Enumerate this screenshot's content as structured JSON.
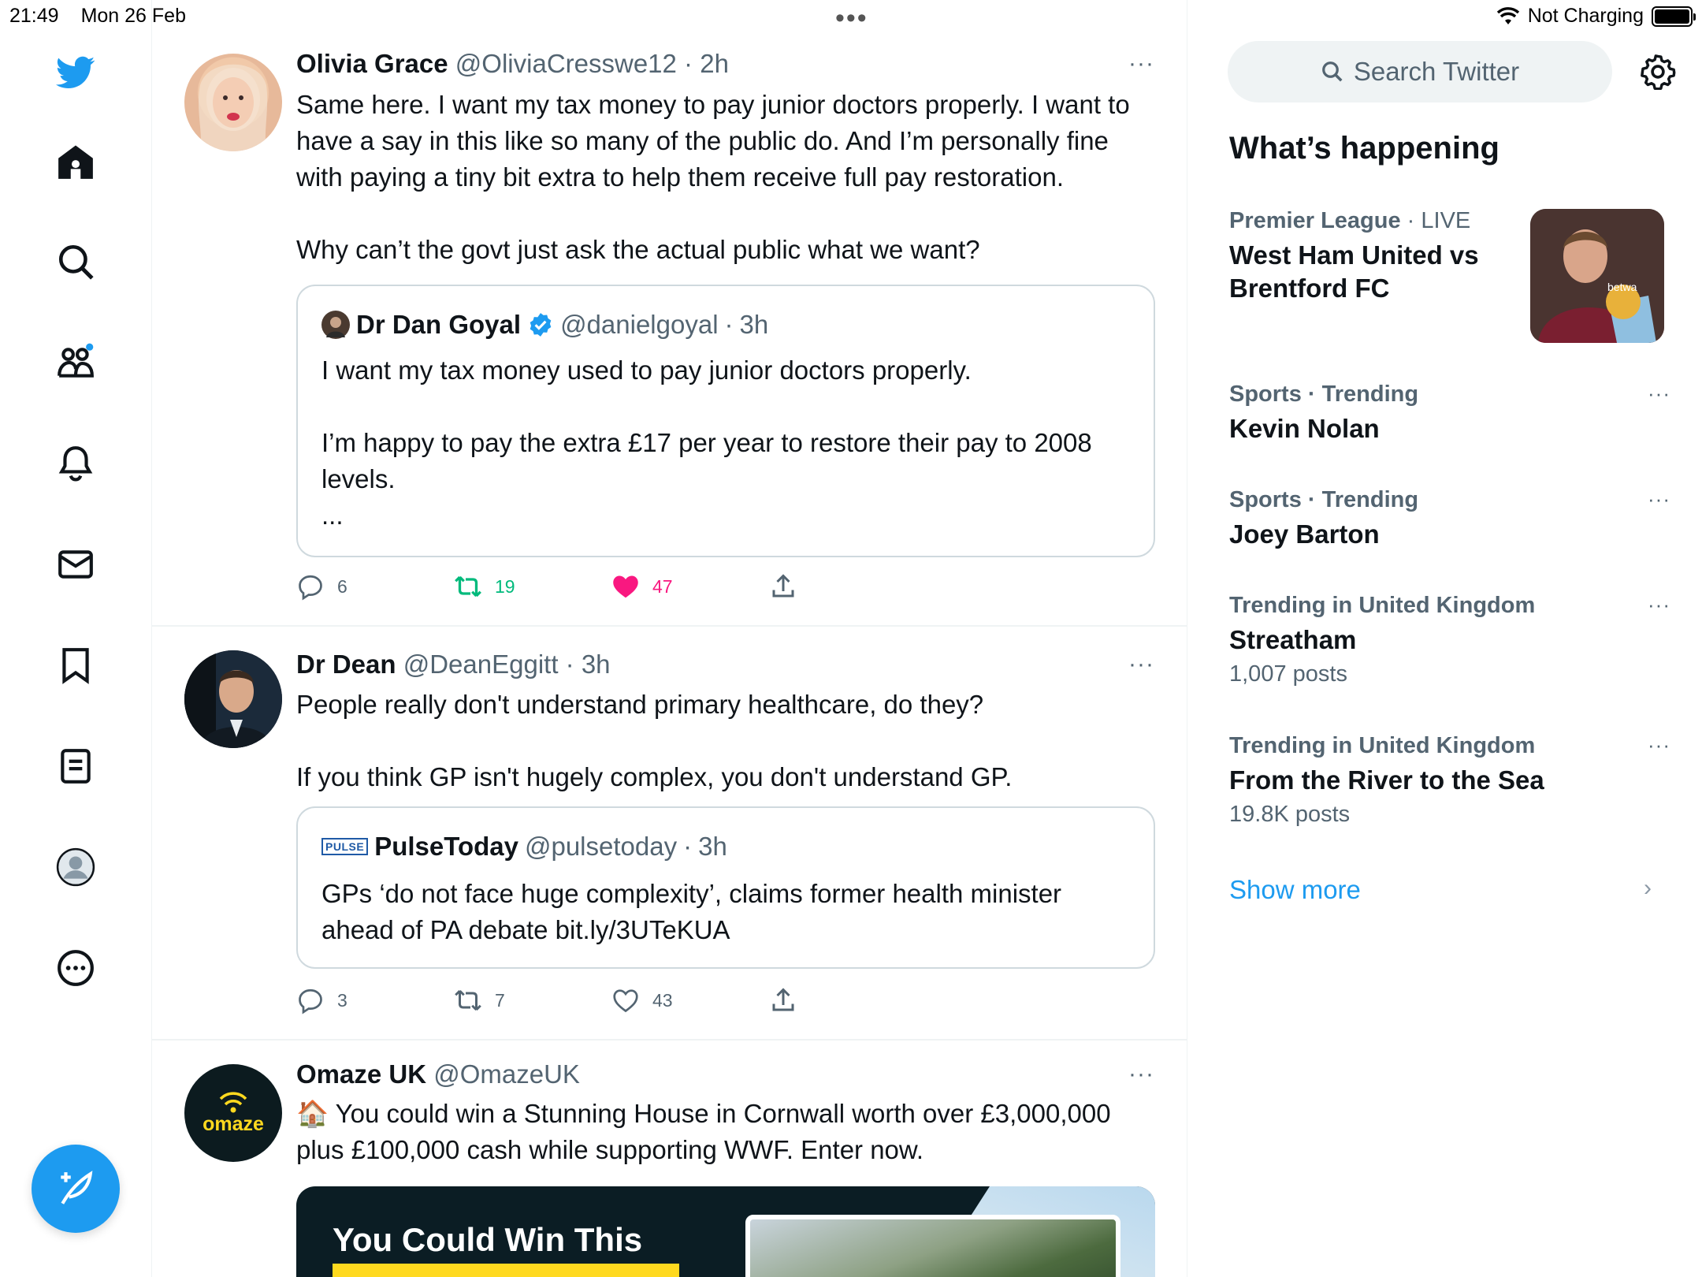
{
  "status_bar": {
    "time": "21:49",
    "date": "Mon 26 Feb",
    "handle_dots": "•••",
    "charging": "Not Charging"
  },
  "tweets": [
    {
      "name": "Olivia Grace",
      "handle": "@OliviaCresswe12",
      "time": "2h",
      "more": "···",
      "text": "Same here. I want my tax money to pay junior doctors properly. I want to have a say in this like so many of the public do. And I’m personally fine with paying a tiny bit extra to help them receive full pay restoration.\n\nWhy can’t the govt just ask the actual public what we want?",
      "quote": {
        "name": "Dr Dan Goyal",
        "handle": "@danielgoyal",
        "time": "3h",
        "verified": true,
        "text": "I want my tax money used to pay junior doctors properly.\n\nI’m happy to pay the extra £17 per year to restore their pay to 2008 levels.\n..."
      },
      "replies": "6",
      "retweets": "19",
      "likes": "47",
      "liked": true,
      "retweeted": true
    },
    {
      "name": "Dr Dean",
      "handle": "@DeanEggitt",
      "time": "3h",
      "more": "···",
      "text": "People really don't understand primary healthcare, do they?\n\nIf you think GP isn't hugely complex, you don't understand GP.",
      "quote": {
        "name": "PulseToday",
        "handle": "@pulsetoday",
        "time": "3h",
        "logo_text": "PULSE",
        "text": "GPs ‘do not face huge complexity’, claims former health minister ahead of PA debate bit.ly/3UTeKUA"
      },
      "replies": "3",
      "retweets": "7",
      "likes": "43",
      "liked": false,
      "retweeted": false
    },
    {
      "name": "Omaze UK",
      "handle": "@OmazeUK",
      "more": "···",
      "avatar_text": "omaze",
      "emoji": "🏠",
      "text": "You could win a Stunning House in Cornwall worth over £3,000,000 plus £100,000 cash while supporting WWF. Enter now.",
      "promo_title": "You Could Win This"
    }
  ],
  "sidebar": {
    "search_placeholder": "Search Twitter",
    "heading": "What’s happening",
    "trends": [
      {
        "category": "Premier League",
        "sep": " · ",
        "status": "LIVE",
        "title": "West Ham United vs Brentford FC"
      },
      {
        "category": "Sports · Trending",
        "title": "Kevin Nolan",
        "more": "···"
      },
      {
        "category": "Sports · Trending",
        "title": "Joey Barton",
        "more": "···"
      },
      {
        "category": "Trending in United Kingdom",
        "title": "Streatham",
        "count": "1,007 posts",
        "more": "···"
      },
      {
        "category": "Trending in United Kingdom",
        "title": "From the River to the Sea",
        "count": "19.8K posts",
        "more": "···"
      }
    ],
    "show_more": "Show more",
    "chevron": "›"
  },
  "colors": {
    "accent": "#1d9bf0",
    "like": "#f91880",
    "retweet": "#00ba7c",
    "muted": "#536471"
  }
}
